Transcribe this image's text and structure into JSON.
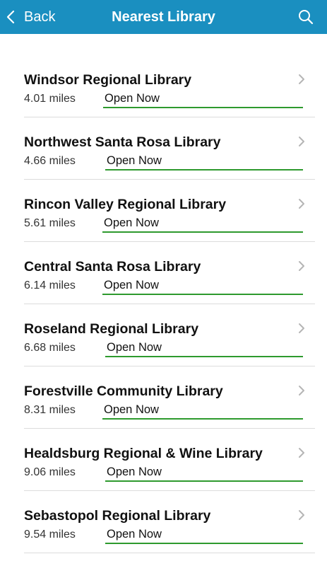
{
  "navbar": {
    "back_label": "Back",
    "title": "Nearest Library",
    "back_icon": "chevron-left-icon",
    "search_icon": "search-icon",
    "background_color": "#1a8fc0"
  },
  "libraries": [
    {
      "name": "Windsor Regional Library",
      "distance": "4.01 miles",
      "status": "Open Now"
    },
    {
      "name": "Northwest Santa Rosa Library",
      "distance": "4.66 miles",
      "status": "Open Now"
    },
    {
      "name": "Rincon Valley Regional Library",
      "distance": "5.61 miles",
      "status": "Open Now"
    },
    {
      "name": "Central Santa Rosa Library",
      "distance": "6.14 miles",
      "status": "Open Now"
    },
    {
      "name": "Roseland Regional Library",
      "distance": "6.68 miles",
      "status": "Open Now"
    },
    {
      "name": "Forestville Community Library",
      "distance": "8.31 miles",
      "status": "Open Now"
    },
    {
      "name": "Healdsburg Regional & Wine Library",
      "distance": "9.06 miles",
      "status": "Open Now"
    },
    {
      "name": "Sebastopol Regional Library",
      "distance": "9.54 miles",
      "status": "Open Now"
    }
  ],
  "colors": {
    "open_underline": "#2e9a2e",
    "divider": "#dcdcdc"
  }
}
